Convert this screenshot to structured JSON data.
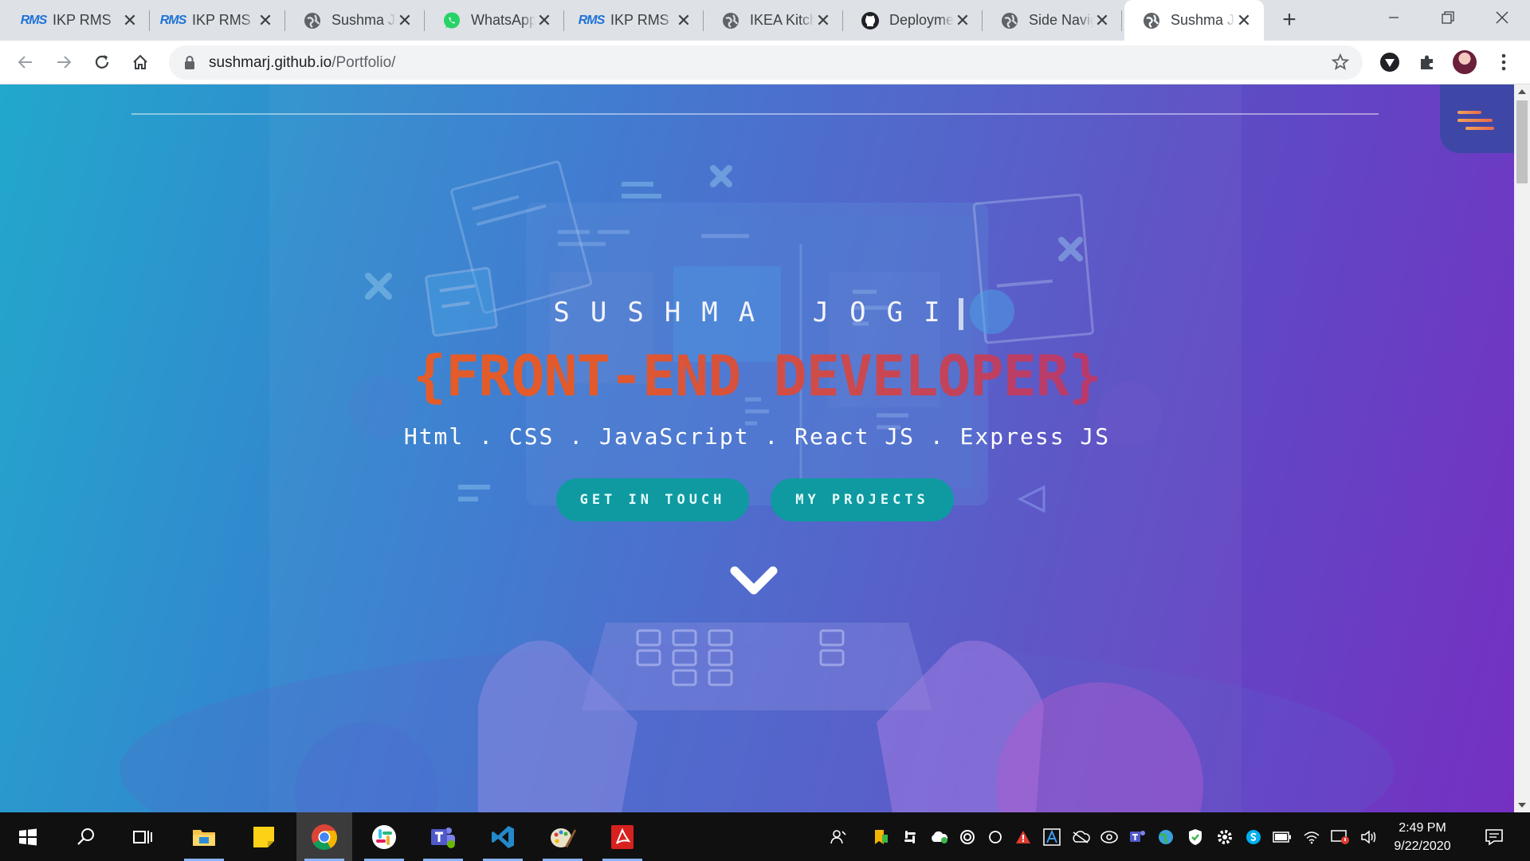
{
  "browser": {
    "tabs": [
      {
        "title": "IKP RMS",
        "icon": "rms-logo-icon",
        "active": false
      },
      {
        "title": "IKP RMS",
        "icon": "rms-logo-icon",
        "active": false
      },
      {
        "title": "Sushma Jogi",
        "icon": "globe-icon",
        "active": false
      },
      {
        "title": "WhatsApp",
        "icon": "whatsapp-icon",
        "active": false
      },
      {
        "title": "IKP RMS",
        "icon": "rms-logo-icon",
        "active": false
      },
      {
        "title": "IKEA Kitchen",
        "icon": "globe-icon",
        "active": false
      },
      {
        "title": "Deployments",
        "icon": "github-icon",
        "active": false
      },
      {
        "title": "Side Navigation",
        "icon": "globe-icon",
        "active": false
      },
      {
        "title": "Sushma Jogi",
        "icon": "globe-icon",
        "active": true
      }
    ],
    "rms_logo_text": "RMS",
    "close_glyph": "✕",
    "new_tab_glyph": "+",
    "address": {
      "host": "sushmarj.github.io",
      "path": "/Portfolio/"
    }
  },
  "page": {
    "name": "SUSHMA JOGI",
    "role": "{FRONT-END DEVELOPER}",
    "skills": "Html . CSS . JavaScript . React JS . Express JS",
    "buttons": {
      "get_in_touch": "GET IN TOUCH",
      "my_projects": "MY PROJECTS"
    },
    "colors": {
      "gradient_start": "#22a8cc",
      "gradient_end": "#7530c2",
      "role_orange": "#e85f24",
      "button_teal": "#0e9aa0"
    }
  },
  "taskbar": {
    "apps": [
      "windows-start-icon",
      "search-icon",
      "task-view-icon",
      "file-explorer-icon",
      "sticky-notes-icon",
      "chrome-icon",
      "slack-icon",
      "teams-icon",
      "vscode-icon",
      "paint-icon",
      "acrobat-icon"
    ],
    "time": "2:49 PM",
    "date": "9/22/2020"
  }
}
